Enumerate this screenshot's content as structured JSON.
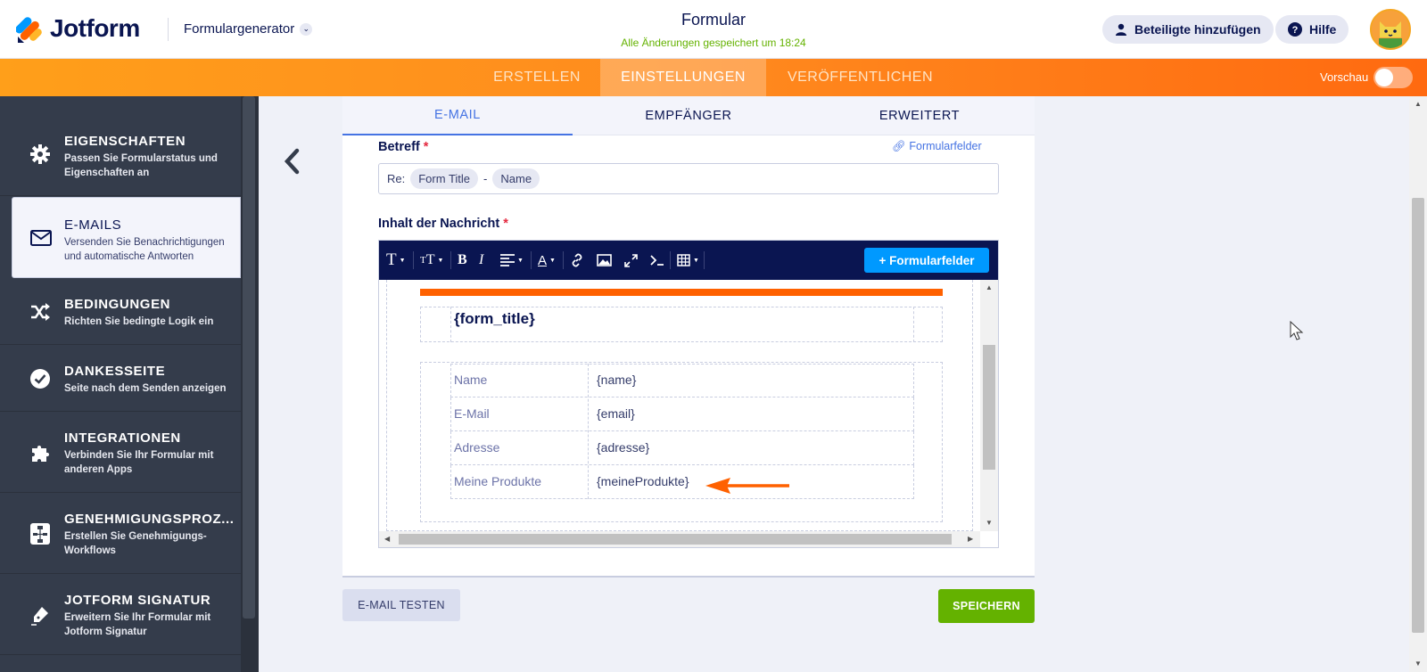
{
  "header": {
    "logo_text": "Jotform",
    "builder_label": "Formulargenerator",
    "form_title": "Formular",
    "saved_status": "Alle Änderungen gespeichert um 18:24",
    "invite_label": "Beteiligte hinzufügen",
    "help_label": "Hilfe"
  },
  "main_tabs": [
    {
      "label": "ERSTELLEN",
      "active": false
    },
    {
      "label": "EINSTELLUNGEN",
      "active": true
    },
    {
      "label": "VERÖFFENTLICHEN",
      "active": false
    }
  ],
  "preview_label": "Vorschau",
  "sidebar": {
    "items": [
      {
        "title": "EIGENSCHAFTEN",
        "desc": "Passen Sie Formularstatus und Eigenschaften an",
        "icon": "gear-icon"
      },
      {
        "title": "E-MAILS",
        "desc": "Versenden Sie Benachrichtigungen und automatische Antworten",
        "icon": "envelope-icon",
        "active": true
      },
      {
        "title": "BEDINGUNGEN",
        "desc": "Richten Sie bedingte Logik ein",
        "icon": "shuffle-icon"
      },
      {
        "title": "DANKESSEITE",
        "desc": "Seite nach dem Senden anzeigen",
        "icon": "check-circle-icon"
      },
      {
        "title": "INTEGRATIONEN",
        "desc": "Verbinden Sie Ihr Formular mit anderen Apps",
        "icon": "puzzle-icon"
      },
      {
        "title": "GENEHMIGUNGSPROZ...",
        "desc": "Erstellen Sie Genehmigungs-Workflows",
        "icon": "workflow-icon"
      },
      {
        "title": "JOTFORM SIGNATUR",
        "desc": "Erweitern Sie Ihr Formular mit Jotform Signatur",
        "icon": "pen-icon"
      }
    ]
  },
  "sub_tabs": [
    {
      "label": "E-MAIL",
      "active": true
    },
    {
      "label": "EMPFÄNGER",
      "active": false
    },
    {
      "label": "ERWEITERT",
      "active": false
    }
  ],
  "subject": {
    "label": "Betreff",
    "required_mark": "*",
    "fields_link": "Formularfelder",
    "prefix": "Re:",
    "chip1": "Form Title",
    "separator": "-",
    "chip2": "Name"
  },
  "message": {
    "label": "Inhalt der Nachricht",
    "required_mark": "*",
    "fields_button": "+ Formularfelder",
    "form_title_var": "{form_title}",
    "rows": [
      {
        "label": "Name",
        "value": "{name}"
      },
      {
        "label": "E-Mail",
        "value": "{email}"
      },
      {
        "label": "Adresse",
        "value": "{adresse}"
      },
      {
        "label": "Meine Produkte",
        "value": "{meineProdukte}"
      }
    ]
  },
  "buttons": {
    "test_email": "E-MAIL TESTEN",
    "save": "SPEICHERN"
  },
  "colors": {
    "accent_orange": "#ff6100",
    "navy": "#0a1551",
    "link_blue": "#4573e3",
    "button_blue": "#0099ff",
    "save_green": "#64b200"
  }
}
